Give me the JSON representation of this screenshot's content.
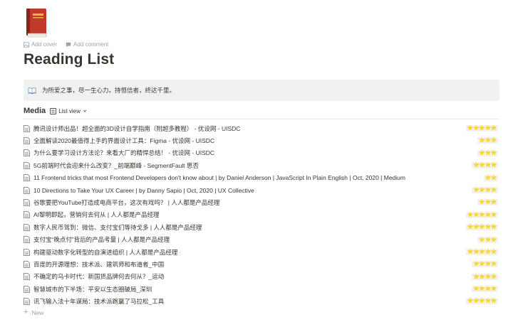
{
  "page": {
    "icon": "red-book-icon",
    "add_cover": "Add cover",
    "add_comment": "Add comment",
    "title": "Reading List"
  },
  "callout": {
    "icon": "open-book-icon",
    "text": "为所爱之事，尽一生心力。持恒信者，终达千里。"
  },
  "database": {
    "title": "Media",
    "view_label": "List view"
  },
  "items": [
    {
      "title": "腾讯设计师出品！超全面的3D设计自学指南（附超多教程） - 优设网 - UISDC",
      "rating": "⭐⭐⭐⭐⭐"
    },
    {
      "title": "全面解读2020最值得上手的界面设计工具：Figma - 优设网 - UISDC",
      "rating": "⭐⭐⭐"
    },
    {
      "title": "为什么要学习设计方法论？来看大厂的精悍总结！ - 优设网 - UISDC",
      "rating": "⭐⭐⭐"
    },
    {
      "title": "5G前端时代会迎来什么改变？_前端巅峰 - SegmentFault 思否",
      "rating": "⭐⭐⭐⭐"
    },
    {
      "title": "11 Frontend tricks that most Frontend Developers don't know about | by Daniel Anderson | JavaScript In Plain English | Oct, 2020 | Medium",
      "rating": "⭐⭐"
    },
    {
      "title": "10 Directions to Take Your UX Career | by Danny Sapio | Oct, 2020 | UX Collective",
      "rating": "⭐⭐⭐⭐"
    },
    {
      "title": "谷歌要把YouTube打造成电商平台，这次有戏吗？ | 人人都是产品经理",
      "rating": "⭐⭐⭐"
    },
    {
      "title": "AI黎明即起，营销何去何从 | 人人都是产品经理",
      "rating": "⭐⭐⭐⭐⭐"
    },
    {
      "title": "数字人民币驾到：微信、支付宝们等待戈多 | 人人都是产品经理",
      "rating": "⭐⭐⭐⭐⭐"
    },
    {
      "title": "支付宝“晚点付”背后的产品考量 | 人人都是产品经理",
      "rating": "⭐⭐⭐"
    },
    {
      "title": "构建驱动数字化转型的自演进组织 | 人人都是产品经理",
      "rating": "⭐⭐⭐⭐⭐"
    },
    {
      "title": "百度的开源理想：技术派、建筑师和布道者_中国",
      "rating": "⭐⭐⭐⭐"
    },
    {
      "title": "不确定的乌卡时代：新国货品牌何去何从？_运动",
      "rating": "⭐⭐⭐⭐"
    },
    {
      "title": "智慧城市的下半场：平安以生态圈破局_深圳",
      "rating": "⭐⭐⭐⭐"
    },
    {
      "title": "讯飞输入法十年谋局：技术派跑赢了马拉松_工具",
      "rating": "⭐⭐⭐⭐⭐"
    }
  ],
  "new_label": "New"
}
